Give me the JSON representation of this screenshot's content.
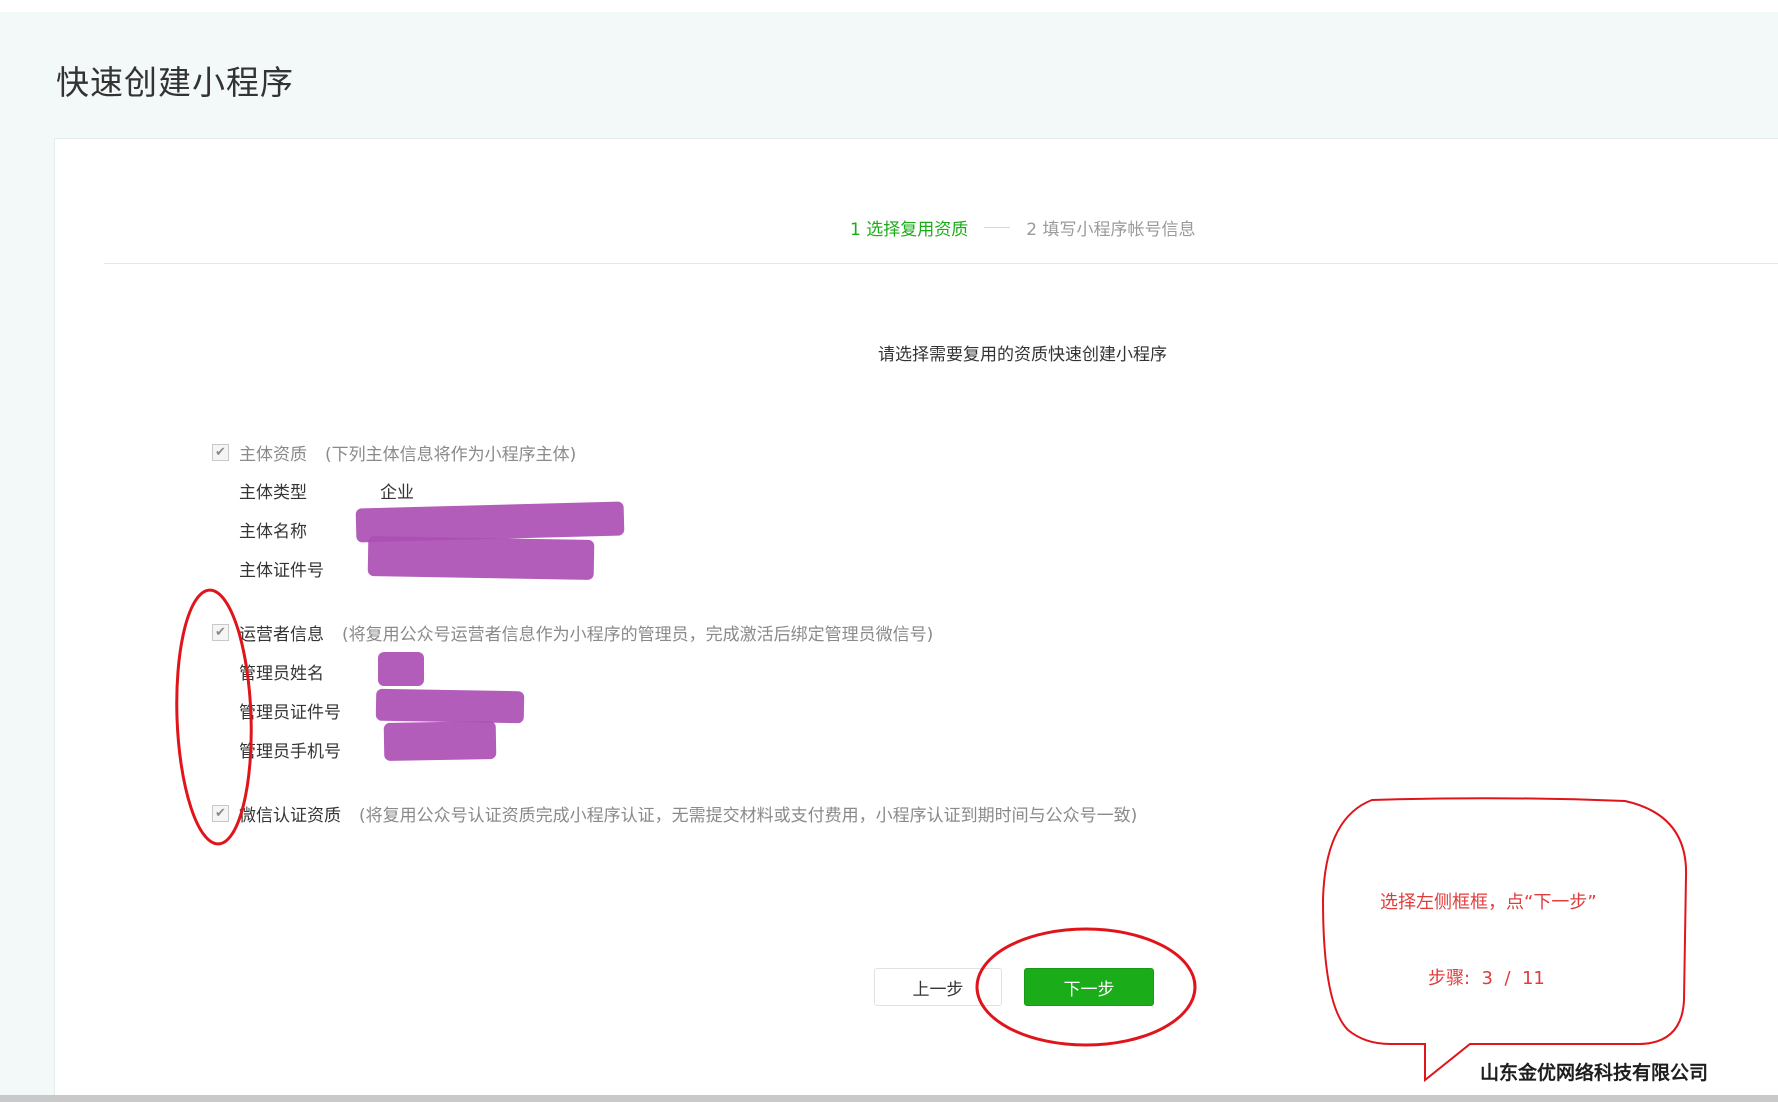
{
  "page": {
    "title": "快速创建小程序"
  },
  "steps": {
    "step1": "1 选择复用资质",
    "step2": "2 填写小程序帐号信息"
  },
  "intro": "请选择需要复用的资质快速创建小程序",
  "sections": {
    "subject": {
      "checked": true,
      "label": "主体资质",
      "note": "(下列主体信息将作为小程序主体)",
      "fields": [
        {
          "label": "主体类型",
          "value": "企业"
        },
        {
          "label": "主体名称",
          "value": ""
        },
        {
          "label": "主体证件号",
          "value": ""
        }
      ]
    },
    "operator": {
      "checked": true,
      "label": "运营者信息",
      "note": "(将复用公众号运营者信息作为小程序的管理员，完成激活后绑定管理员微信号)",
      "fields": [
        {
          "label": "管理员姓名",
          "value": ""
        },
        {
          "label": "管理员证件号",
          "value": ""
        },
        {
          "label": "管理员手机号",
          "value": ""
        }
      ]
    },
    "certification": {
      "checked": true,
      "label": "微信认证资质",
      "note": "(将复用公众号认证资质完成小程序认证，无需提交材料或支付费用，小程序认证到期时间与公众号一致)"
    }
  },
  "buttons": {
    "prev": "上一步",
    "next": "下一步"
  },
  "annotation": {
    "instruction": "选择左侧框框，点“下一步”",
    "step_label": "步骤:",
    "step_current": "3",
    "step_sep": "/",
    "step_total": "11"
  },
  "company": "山东金优网络科技有限公司",
  "colors": {
    "accent_green": "#1aad19",
    "annotation_red": "#e03c3c",
    "redaction": "#ad4fb4"
  }
}
